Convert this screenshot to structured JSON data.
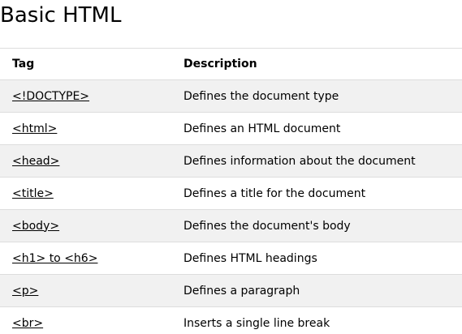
{
  "page": {
    "title": "Basic HTML"
  },
  "table": {
    "headers": {
      "tag": "Tag",
      "description": "Description"
    },
    "rows": [
      {
        "tag": "<!DOCTYPE>",
        "description": "Defines the document type"
      },
      {
        "tag": "<html>",
        "description": "Defines an HTML document"
      },
      {
        "tag": "<head>",
        "description": "Defines information about the document"
      },
      {
        "tag": "<title>",
        "description": "Defines a title for the document"
      },
      {
        "tag": "<body>",
        "description": "Defines the document's body"
      },
      {
        "tag": "<h1> to <h6>",
        "description": "Defines HTML headings"
      },
      {
        "tag": "<p>",
        "description": "Defines a paragraph"
      },
      {
        "tag": "<br>",
        "description": "Inserts a single line break"
      }
    ]
  },
  "colors": {
    "row_alt": "#f1f1f1",
    "row": "#ffffff",
    "border": "#dddddd",
    "text": "#000000"
  }
}
